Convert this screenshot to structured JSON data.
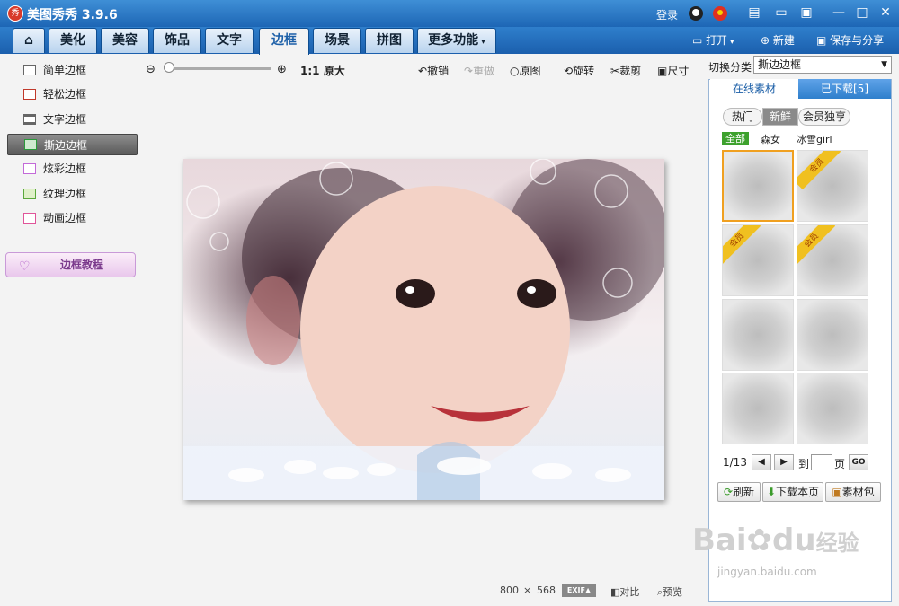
{
  "app": {
    "title": "美图秀秀 3.9.6",
    "logo": "秀"
  },
  "titlebar": {
    "login": "登录",
    "icons": [
      "qq-icon",
      "weibo-icon"
    ],
    "window_icons": [
      "skin-icon",
      "feedback-icon",
      "menu-icon",
      "minimize-icon",
      "maximize-icon",
      "close-icon"
    ]
  },
  "tabs": [
    {
      "label": "美化"
    },
    {
      "label": "美容"
    },
    {
      "label": "饰品"
    },
    {
      "label": "文字"
    },
    {
      "label": "边框",
      "active": true
    },
    {
      "label": "场景"
    },
    {
      "label": "拼图"
    },
    {
      "label": "更多功能"
    }
  ],
  "top_actions": {
    "open": "打开",
    "new": "新建",
    "save": "保存与分享"
  },
  "left": {
    "categories": [
      "简单边框",
      "轻松边框",
      "文字边框",
      "撕边边框",
      "炫彩边框",
      "纹理边框",
      "动画边框"
    ],
    "active_index": 3,
    "tutorial": "边框教程"
  },
  "toolbar": {
    "zoom_ratio": "1:1",
    "original_size": "原大",
    "undo": "撤销",
    "redo": "重做",
    "original": "原图",
    "rotate": "旋转",
    "crop": "裁剪",
    "resize": "尺寸"
  },
  "right": {
    "switch_label": "切换分类",
    "category_value": "撕边边框",
    "tab_online": "在线素材",
    "tab_downloaded": "已下载[5]",
    "sort_hot": "热门",
    "sort_new": "新鲜",
    "sort_member": "会员独享",
    "filter_all": "全部",
    "filter_1": "森女",
    "filter_2": "冰雪girl",
    "member_badge": "会员",
    "page": "1/13",
    "goto": "到",
    "page_unit": "页",
    "go": "GO",
    "refresh": "刷新",
    "download_page": "下载本页",
    "package": "素材包"
  },
  "status": {
    "width": "800",
    "times": "×",
    "height": "568",
    "exif": "EXIF▲",
    "compare": "对比",
    "preview": "预览"
  },
  "watermark": {
    "line1": "Bai",
    "line2": "du",
    "line3": "经验",
    "line4": "jingyan.baidu.com"
  }
}
